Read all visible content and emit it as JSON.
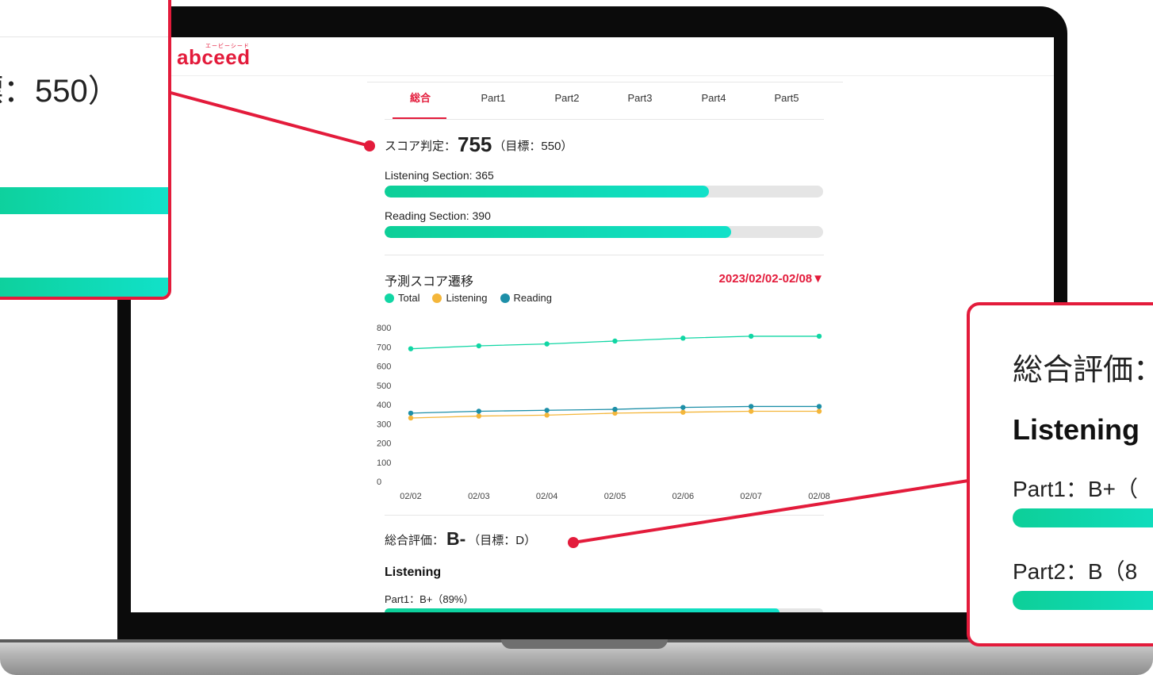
{
  "app": {
    "logo": "abceed",
    "logo_ruby": "エービーシード"
  },
  "tabs": [
    {
      "label": "総合",
      "active": true
    },
    {
      "label": "Part1",
      "active": false
    },
    {
      "label": "Part2",
      "active": false
    },
    {
      "label": "Part3",
      "active": false
    },
    {
      "label": "Part4",
      "active": false
    },
    {
      "label": "Part5",
      "active": false
    }
  ],
  "score": {
    "label": "スコア判定：",
    "value": "755",
    "target": "（目標：550）"
  },
  "sections": [
    {
      "label": "Listening Section: 365",
      "progress": 0.74
    },
    {
      "label": "Reading Section: 390",
      "progress": 0.79
    }
  ],
  "chart_header": {
    "title": "予測スコア遷移",
    "date_range": "2023/02/02-02/08▼"
  },
  "chart_data": {
    "type": "line",
    "x": [
      "02/02",
      "02/03",
      "02/04",
      "02/05",
      "02/06",
      "02/07",
      "02/08"
    ],
    "ylim": [
      0,
      800
    ],
    "yticks": [
      "0",
      "100",
      "200",
      "300",
      "400",
      "500",
      "600",
      "700",
      "800"
    ],
    "series": [
      {
        "name": "Total",
        "color": "#11d6a4",
        "values": [
          690,
          705,
          715,
          730,
          745,
          755,
          755
        ]
      },
      {
        "name": "Listening",
        "color": "#f4b63a",
        "values": [
          330,
          340,
          345,
          355,
          360,
          365,
          365
        ]
      },
      {
        "name": "Reading",
        "color": "#1d8fa8",
        "values": [
          355,
          365,
          370,
          375,
          385,
          390,
          390
        ]
      }
    ],
    "legend_position": "top-left"
  },
  "evaluation": {
    "label": "総合評価：",
    "grade": "B-",
    "target": "（目標：D）"
  },
  "listening": {
    "heading": "Listening",
    "parts": [
      {
        "label": "Part1：B+（89%）",
        "progress": 0.9
      }
    ]
  },
  "callout_left": {
    "score_text": "標：550）"
  },
  "callout_right": {
    "eval_text": "総合評価：",
    "heading": "Listening",
    "parts": [
      {
        "label": "Part1：B+（"
      },
      {
        "label": "Part2：B（8"
      }
    ]
  },
  "colors": {
    "accent": "#e31b3b",
    "bar": "#11d6a4"
  }
}
